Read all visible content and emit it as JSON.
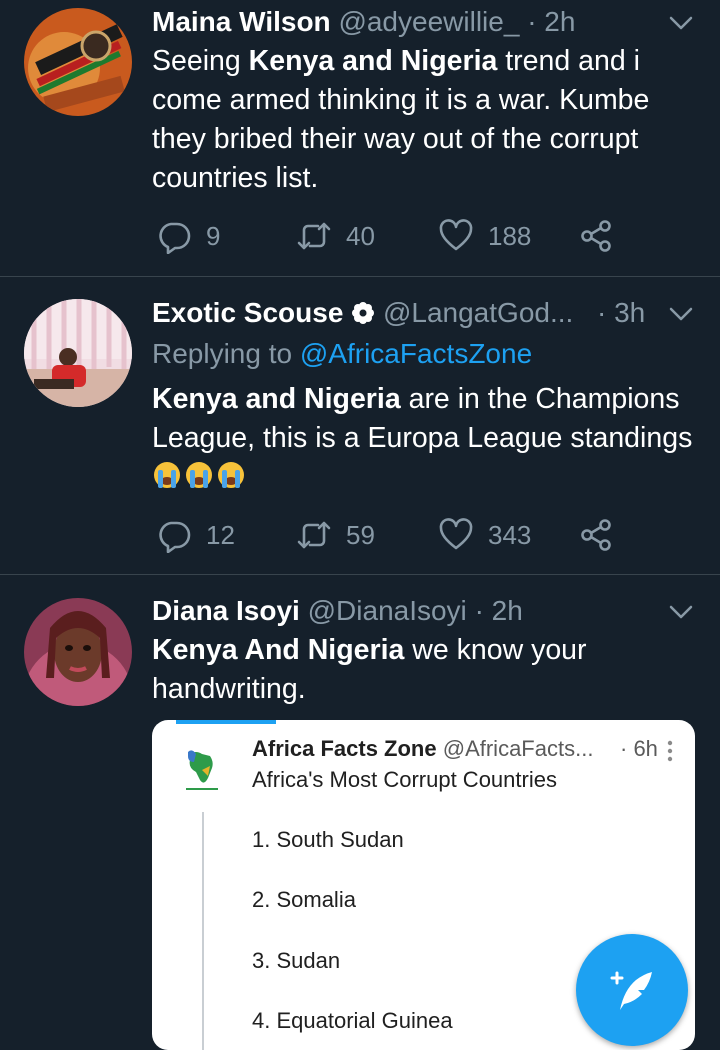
{
  "tweets": [
    {
      "name": "Maina Wilson",
      "handle": "@adyeewillie_",
      "time": "· 2h",
      "text_bold_1": "Kenya and Nigeria",
      "text_pre": "Seeing ",
      "text_post": " trend and i come armed thinking it is a war. Kumbe they bribed their way out of the corrupt countries list.",
      "replies": "9",
      "retweets": "40",
      "likes": "188"
    },
    {
      "name": "Exotic Scouse",
      "handle": "@LangatGod...",
      "time": "· 3h",
      "replying_prefix": "Replying to ",
      "replying_handle": "@AfricaFactsZone",
      "text_bold_1": "Kenya and Nigeria",
      "text_post": " are in the Champions League, this is a Europa League standings",
      "replies": "12",
      "retweets": "59",
      "likes": "343"
    },
    {
      "name": "Diana Isoyi",
      "handle": "@DianaIsoyi",
      "time": "· 2h",
      "text_bold_1": "Kenya And Nigeria",
      "text_post": " we know your handwriting."
    }
  ],
  "quote": {
    "name": "Africa Facts Zone",
    "handle": "@AfricaFacts...",
    "time": "· 6h",
    "title": "Africa's Most Corrupt Countries",
    "items": [
      "1. South Sudan",
      "2. Somalia",
      "3. Sudan",
      "4. Equatorial Guinea"
    ]
  },
  "colors": {
    "background": "#15202b",
    "accent": "#1da1f2",
    "muted": "#8899a6"
  },
  "icons": {
    "reply": "reply-icon",
    "retweet": "retweet-icon",
    "like": "like-icon",
    "share": "share-icon",
    "compose": "compose-tweet-icon"
  }
}
